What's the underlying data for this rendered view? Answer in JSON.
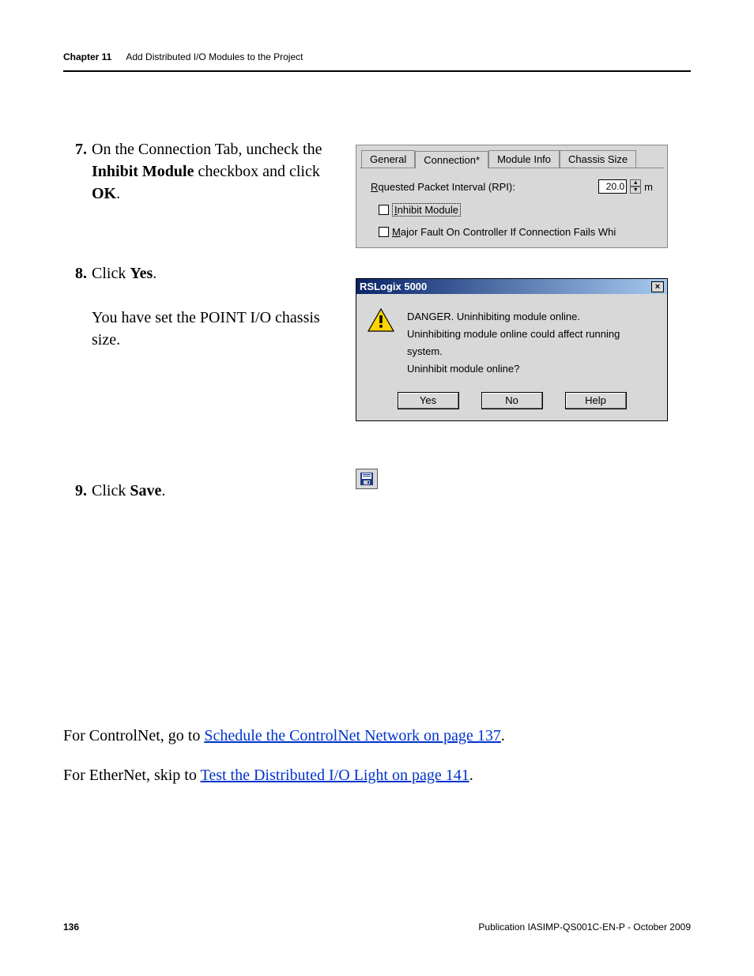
{
  "header": {
    "chapter": "Chapter 11",
    "title": "Add Distributed I/O Modules to the Project"
  },
  "steps": {
    "s7": {
      "num": "7.",
      "pre": "On the Connection Tab, uncheck the ",
      "bold1": "Inhibit Module",
      "mid": " checkbox and click ",
      "bold2": "OK",
      "post": "."
    },
    "s8": {
      "num": "8.",
      "pre": "Click ",
      "bold": "Yes",
      "post": ".",
      "follow": "You have set the POINT I/O chassis size."
    },
    "s9": {
      "num": "9.",
      "pre": "Click ",
      "bold": "Save",
      "post": "."
    }
  },
  "tabs": {
    "general": "General",
    "connection": "Connection*",
    "moduleinfo": "Module Info",
    "chassis": "Chassis Size"
  },
  "conn": {
    "rpi_label_pre": "R",
    "rpi_label_u": "e",
    "rpi_label_post": "quested Packet Interval (RPI):",
    "rpi_value": "20.0",
    "rpi_unit": "m",
    "inhibit_u": "I",
    "inhibit_label": "nhibit Module",
    "fault_u": "M",
    "fault_label": "ajor Fault On Controller If Connection Fails Whi"
  },
  "dialog": {
    "title": "RSLogix 5000",
    "line1": "DANGER. Uninhibiting module online.",
    "line2": "Uninhibiting module online could affect running system.",
    "line3": "Uninhibit module online?",
    "yes": "Yes",
    "no": "No",
    "help": "Help",
    "close": "×"
  },
  "crosslinks": {
    "l1_pre": "For ControlNet, go to ",
    "l1_link": "Schedule the ControlNet Network on page 137",
    "l1_post": ".",
    "l2_pre": "For EtherNet, skip to ",
    "l2_link": "Test the Distributed I/O Light on page 141",
    "l2_post": "."
  },
  "footer": {
    "page": "136",
    "pub": "Publication IASIMP-QS001C-EN-P - October 2009"
  }
}
